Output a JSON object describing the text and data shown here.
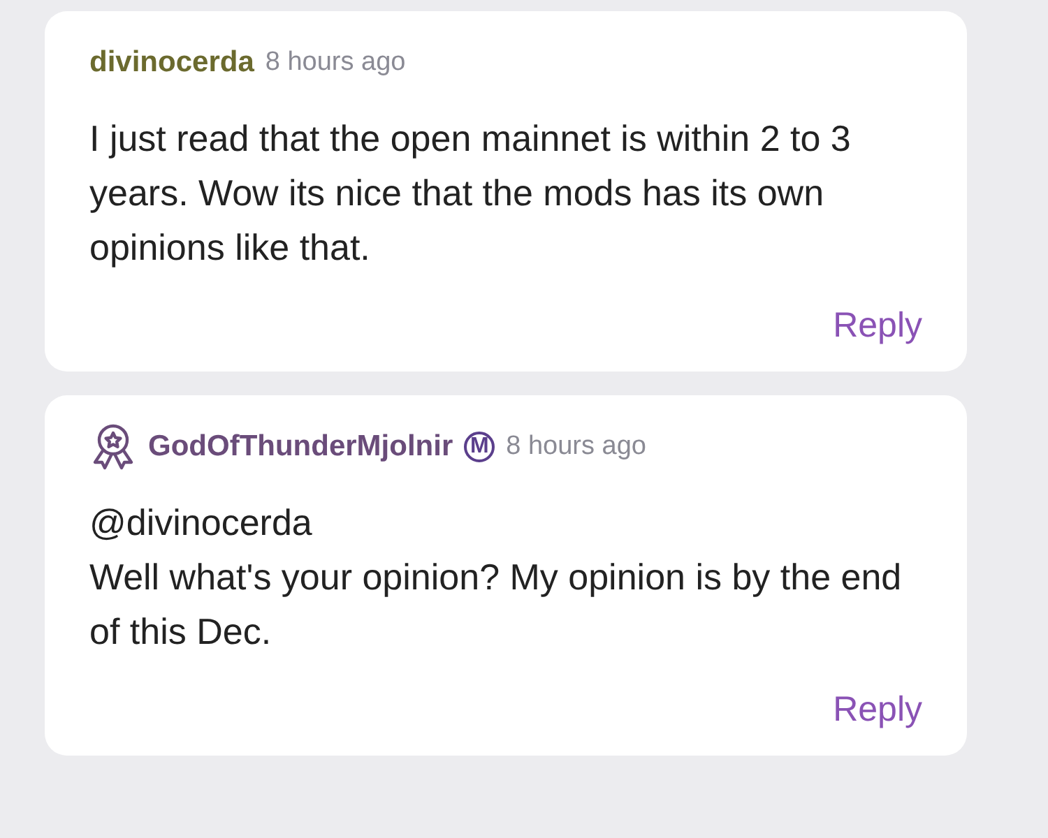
{
  "comments": [
    {
      "author": "divinocerda",
      "color": "#6b6a2e",
      "award": false,
      "moderator": false,
      "time": "8 hours ago",
      "lines": [
        "I just read that the open mainnet is within 2 to 3 years. Wow its nice that the mods has its own opinions like that."
      ],
      "reply": "Reply"
    },
    {
      "author": "GodOfThunderMjolnir",
      "color": "#6a4c7a",
      "award": true,
      "moderator": true,
      "moderator_label": "M",
      "time": "8 hours ago",
      "lines": [
        "@divinocerda",
        "Well what's your opinion? My opinion is by the end of this Dec."
      ],
      "reply": "Reply"
    }
  ]
}
